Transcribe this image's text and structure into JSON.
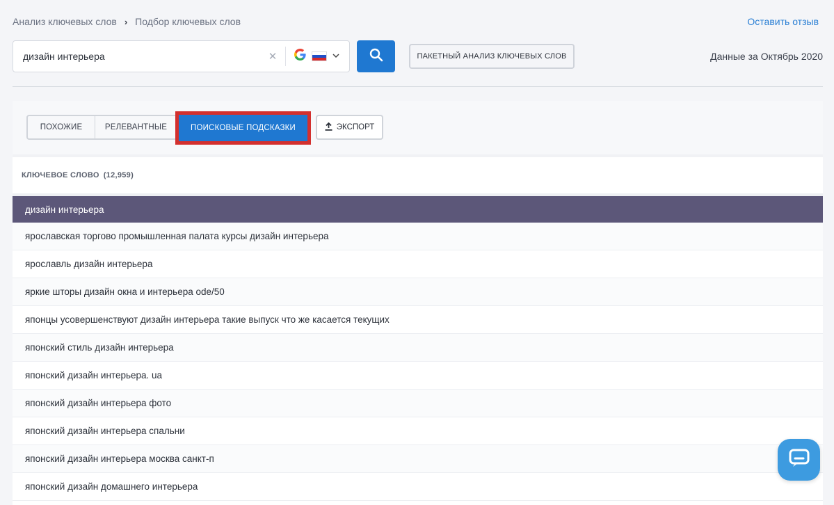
{
  "breadcrumb": {
    "items": [
      "Анализ ключевых слов",
      "Подбор ключевых слов"
    ],
    "separator": "›"
  },
  "feedback_link": "Оставить отзыв",
  "search": {
    "value": "дизайн интерьера",
    "clear_icon": "close-icon",
    "engine_icon": "google-logo-icon",
    "country_flag": "russia-flag-icon"
  },
  "search_button_icon": "search-icon",
  "batch_button_label": "ПАКЕТНЫЙ АНАЛИЗ КЛЮЧЕВЫХ СЛОВ",
  "data_period": "Данные за Октябрь 2020",
  "tabs": [
    {
      "label": "ПОХОЖИЕ",
      "active": false
    },
    {
      "label": "РЕЛЕВАНТНЫЕ",
      "active": false
    },
    {
      "label": "ПОИСКОВЫЕ ПОДСКАЗКИ",
      "active": true
    }
  ],
  "export_label": "ЭКСПОРТ",
  "table": {
    "header": "КЛЮЧЕВОЕ СЛОВО",
    "count": "(12,959)",
    "rows": [
      "дизайн интерьера",
      "ярославская торгово промышленная палата курсы дизайн интерьера",
      "ярославль дизайн интерьера",
      "яркие шторы дизайн окна и интерьера ode/50",
      "японцы усовершенствуют дизайн интерьера такие выпуск что же касается текущих",
      "японский стиль дизайн интерьера",
      "японский дизайн интерьера. ua",
      "японский дизайн интерьера фото",
      "японский дизайн интерьера спальни",
      "японский дизайн интерьера москва санкт-п",
      "японский дизайн домашнего интерьера"
    ]
  },
  "colors": {
    "accent": "#1f78d1",
    "highlight_row": "#5c5779",
    "highlight_border": "#d3302e",
    "chat": "#3d9be0"
  },
  "chat_icon": "chat-bubble-icon"
}
